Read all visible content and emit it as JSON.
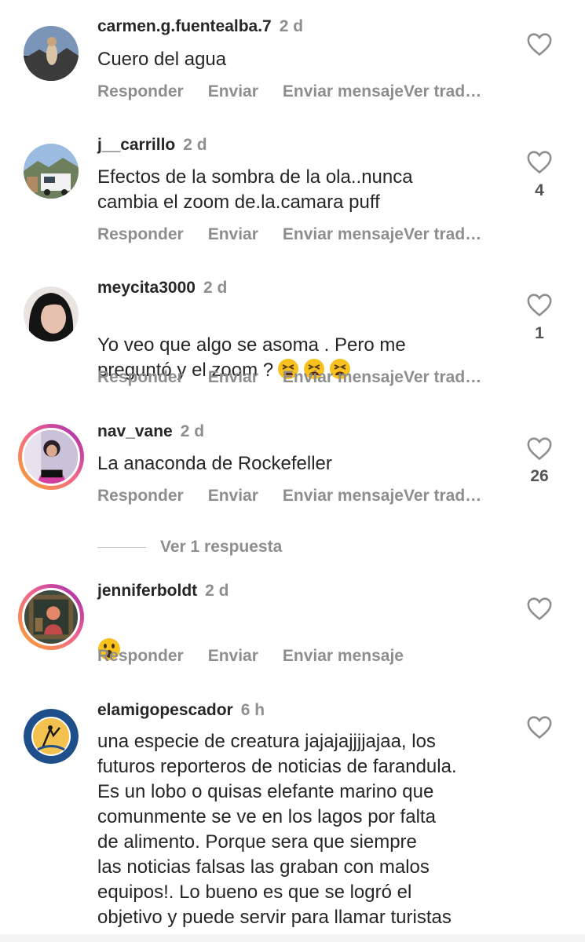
{
  "comments": [
    {
      "username": "carmen.g.fuentealba.7",
      "time": "2 d",
      "text": "Cuero del agua",
      "likes": "",
      "actions": [
        "Responder",
        "Enviar",
        "Enviar mensaje",
        "Ver trad…"
      ]
    },
    {
      "username": "j__carrillo",
      "time": "2 d",
      "text": "Efectos de la sombra de la ola..nunca\ncambia el zoom de.la.camara puff",
      "likes": "4",
      "actions": [
        "Responder",
        "Enviar",
        "Enviar mensaje",
        "Ver trad…"
      ]
    },
    {
      "username": "meycita3000",
      "time": "2 d",
      "text": "Yo veo que algo se asoma . Pero me\npreguntó y el zoom ?",
      "likes": "1",
      "actions": [
        "Responder",
        "Enviar",
        "Enviar mensaje",
        "Ver trad…"
      ]
    },
    {
      "username": "nav_vane",
      "time": "2 d",
      "text": "La anaconda de Rockefeller",
      "likes": "26",
      "actions": [
        "Responder",
        "Enviar",
        "Enviar mensaje",
        "Ver trad…"
      ]
    },
    {
      "username": "jenniferboldt",
      "time": "2 d",
      "text": "",
      "likes": "",
      "actions": [
        "Responder",
        "Enviar",
        "Enviar mensaje"
      ]
    },
    {
      "username": "elamigopescador",
      "time": "6 h",
      "text": "una especie de creatura jajajajjjjajaa, los\nfuturos reporteros de noticias de farandula.\nEs un lobo o quisas elefante marino que\ncomunmente se ve en los lagos por falta\nde alimento. Porque sera que siempre\nlas noticias falsas las graban con malos\nequipos!. Lo bueno es que se logró el\nobjetivo y puede servir para llamar turistas",
      "likes": "",
      "actions": []
    }
  ],
  "view_replies": "Ver 1 respuesta",
  "icons": {
    "like": "heart-outline-icon",
    "tired_emoji": "tired-face-emoji",
    "surprised_emoji": "surprised-face-emoji"
  },
  "colors": {
    "text": "#262626",
    "secondary": "#8e8e8e",
    "story_ring_start": "#f9a825",
    "story_ring_end": "#9c27b0"
  }
}
